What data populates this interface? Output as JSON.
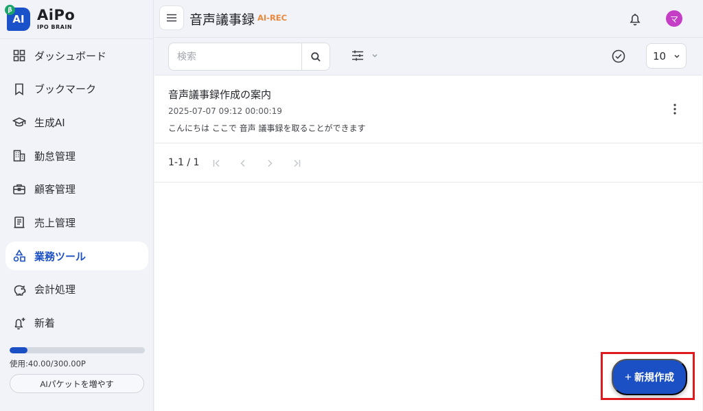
{
  "app": {
    "name": "AiPo",
    "subtitle": "IPO BRAIN",
    "logo_text": "AI",
    "beta": "β"
  },
  "sidebar": {
    "items": [
      {
        "label": "ダッシュボード",
        "icon": "dashboard-icon"
      },
      {
        "label": "ブックマーク",
        "icon": "bookmark-icon"
      },
      {
        "label": "生成AI",
        "icon": "graduation-cap-icon"
      },
      {
        "label": "勤怠管理",
        "icon": "building-icon"
      },
      {
        "label": "顧客管理",
        "icon": "briefcase-icon"
      },
      {
        "label": "売上管理",
        "icon": "receipt-icon"
      },
      {
        "label": "業務ツール",
        "icon": "shapes-icon",
        "active": true
      },
      {
        "label": "会計処理",
        "icon": "piggy-bank-icon"
      },
      {
        "label": "新着",
        "icon": "bell-plus-icon"
      }
    ],
    "usage": {
      "text": "使用:40.00/300.00P",
      "used": 40,
      "total": 300
    },
    "aipacket_button": "AIパケットを増やす"
  },
  "header": {
    "title": "音声議事録",
    "badge": "AI-REC",
    "avatar": "マ"
  },
  "toolbar": {
    "search_placeholder": "検索",
    "search_value": "",
    "per_page": "10"
  },
  "records": [
    {
      "title": "音声議事録作成の案内",
      "meta": "2025-07-07 09:12  00:00:19",
      "desc": "こんにちは ここで 音声 議事録を取ることができます"
    }
  ],
  "pagination": {
    "text": "1-1 / 1"
  },
  "fab": {
    "plus": "+",
    "label": "新規作成"
  },
  "colors": {
    "accent": "#1b4fc4",
    "badge": "#e9883c",
    "avatar": "#c53fc6",
    "highlight": "#e0191e"
  }
}
